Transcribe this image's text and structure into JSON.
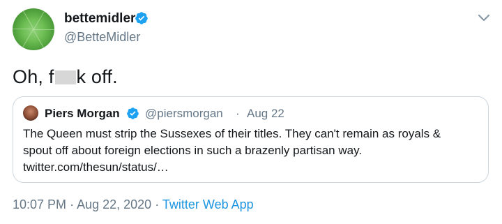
{
  "author": {
    "display_name": "bettemidler",
    "handle": "@BetteMidler"
  },
  "tweet": {
    "text_before": "Oh, f",
    "text_after": "k off."
  },
  "quoted_tweet": {
    "display_name": "Piers Morgan",
    "handle": "@piersmorgan",
    "separator": "·",
    "date": "Aug 22",
    "body_lines": [
      "The Queen must strip the Sussexes of their titles. They can't remain as royals &",
      "spout  off about foreign elections in such a brazenly partisan way.",
      "twitter.com/thesun/status/…"
    ]
  },
  "meta": {
    "time": "10:07 PM",
    "separator_1": "·",
    "date": "Aug 22, 2020",
    "separator_2": "·",
    "app": "Twitter Web App"
  },
  "icons": {
    "verified": "verified-badge-icon",
    "menu": "chevron-down-icon"
  },
  "colors": {
    "verified_blue": "#1da1f2",
    "link_blue": "#1b95e0",
    "secondary_text": "#657786",
    "border": "#ccd6dd"
  }
}
